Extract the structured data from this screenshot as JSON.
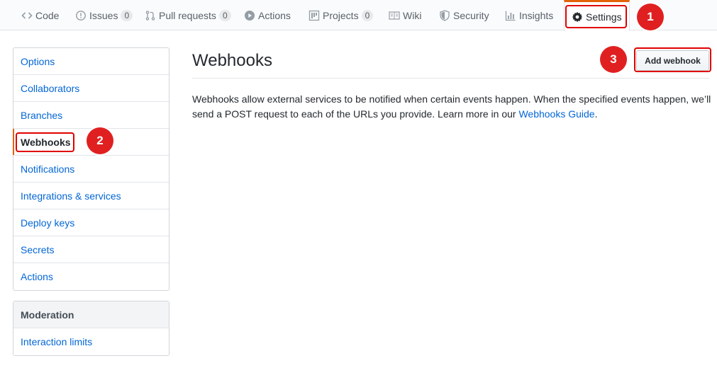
{
  "tabs": [
    {
      "label": "Code",
      "icon": "code-icon"
    },
    {
      "label": "Issues",
      "icon": "issue-icon",
      "count": "0"
    },
    {
      "label": "Pull requests",
      "icon": "pull-request-icon",
      "count": "0"
    },
    {
      "label": "Actions",
      "icon": "play-icon"
    },
    {
      "label": "Projects",
      "icon": "project-icon",
      "count": "0"
    },
    {
      "label": "Wiki",
      "icon": "book-icon"
    },
    {
      "label": "Security",
      "icon": "shield-icon"
    },
    {
      "label": "Insights",
      "icon": "graph-icon"
    },
    {
      "label": "Settings",
      "icon": "gear-icon",
      "selected": true
    }
  ],
  "sidebar": {
    "items": [
      {
        "label": "Options"
      },
      {
        "label": "Collaborators"
      },
      {
        "label": "Branches"
      },
      {
        "label": "Webhooks",
        "selected": true
      },
      {
        "label": "Notifications"
      },
      {
        "label": "Integrations & services"
      },
      {
        "label": "Deploy keys"
      },
      {
        "label": "Secrets"
      },
      {
        "label": "Actions"
      }
    ],
    "moderation": {
      "heading": "Moderation",
      "items": [
        {
          "label": "Interaction limits"
        }
      ]
    }
  },
  "main": {
    "title": "Webhooks",
    "add_button": "Add webhook",
    "description_text": "Webhooks allow external services to be notified when certain events happen. When the specified events happen, we’ll send a POST request to each of the URLs you provide. Learn more in our ",
    "description_link": "Webhooks Guide",
    "description_end": "."
  },
  "callouts": [
    "1",
    "2",
    "3"
  ],
  "colors": {
    "accent": "#e36209",
    "link": "#0366d6",
    "callout": "#e02020"
  }
}
